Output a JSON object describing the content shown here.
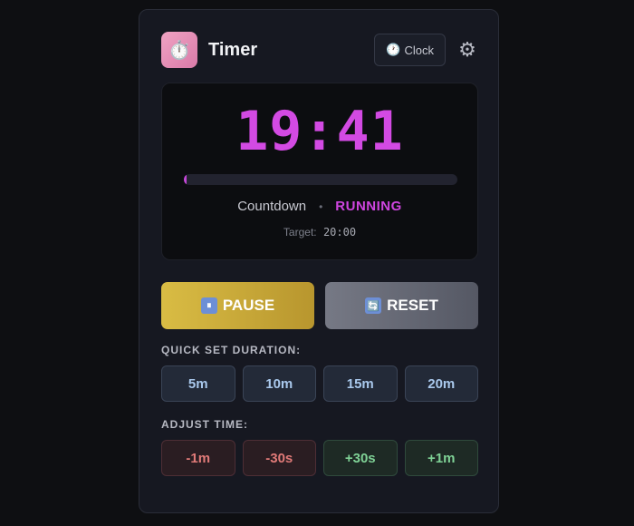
{
  "header": {
    "app_icon": "stopwatch-icon",
    "app_icon_glyph": "⏱️",
    "title": "Timer",
    "clock_button": {
      "icon": "clock-icon",
      "glyph": "🕐",
      "label": "Clock"
    },
    "settings_icon": "gear-icon",
    "settings_glyph": "⚙"
  },
  "display": {
    "time": "19:41",
    "progress_fraction": 0.0075,
    "mode": "Countdown",
    "separator": "•",
    "state": "RUNNING",
    "target_label": "Target:",
    "target_value": "20:00"
  },
  "actions": {
    "pause": {
      "icon": "pause-icon",
      "glyph": "⏸",
      "label": "PAUSE"
    },
    "reset": {
      "icon": "reset-icon",
      "glyph": "🔄",
      "label": "RESET"
    }
  },
  "quick_set": {
    "label": "QUICK SET DURATION:",
    "presets": [
      "5m",
      "10m",
      "15m",
      "20m"
    ]
  },
  "adjust": {
    "label": "ADJUST TIME:",
    "buttons": [
      "-1m",
      "-30s",
      "+30s",
      "+1m"
    ]
  },
  "colors": {
    "accent": "#d34ae3",
    "pause": "#d9bc44",
    "reset": "#6a6d78",
    "minus": "#e07a78",
    "plus": "#7fd296",
    "preset": "#a9c8ec"
  }
}
